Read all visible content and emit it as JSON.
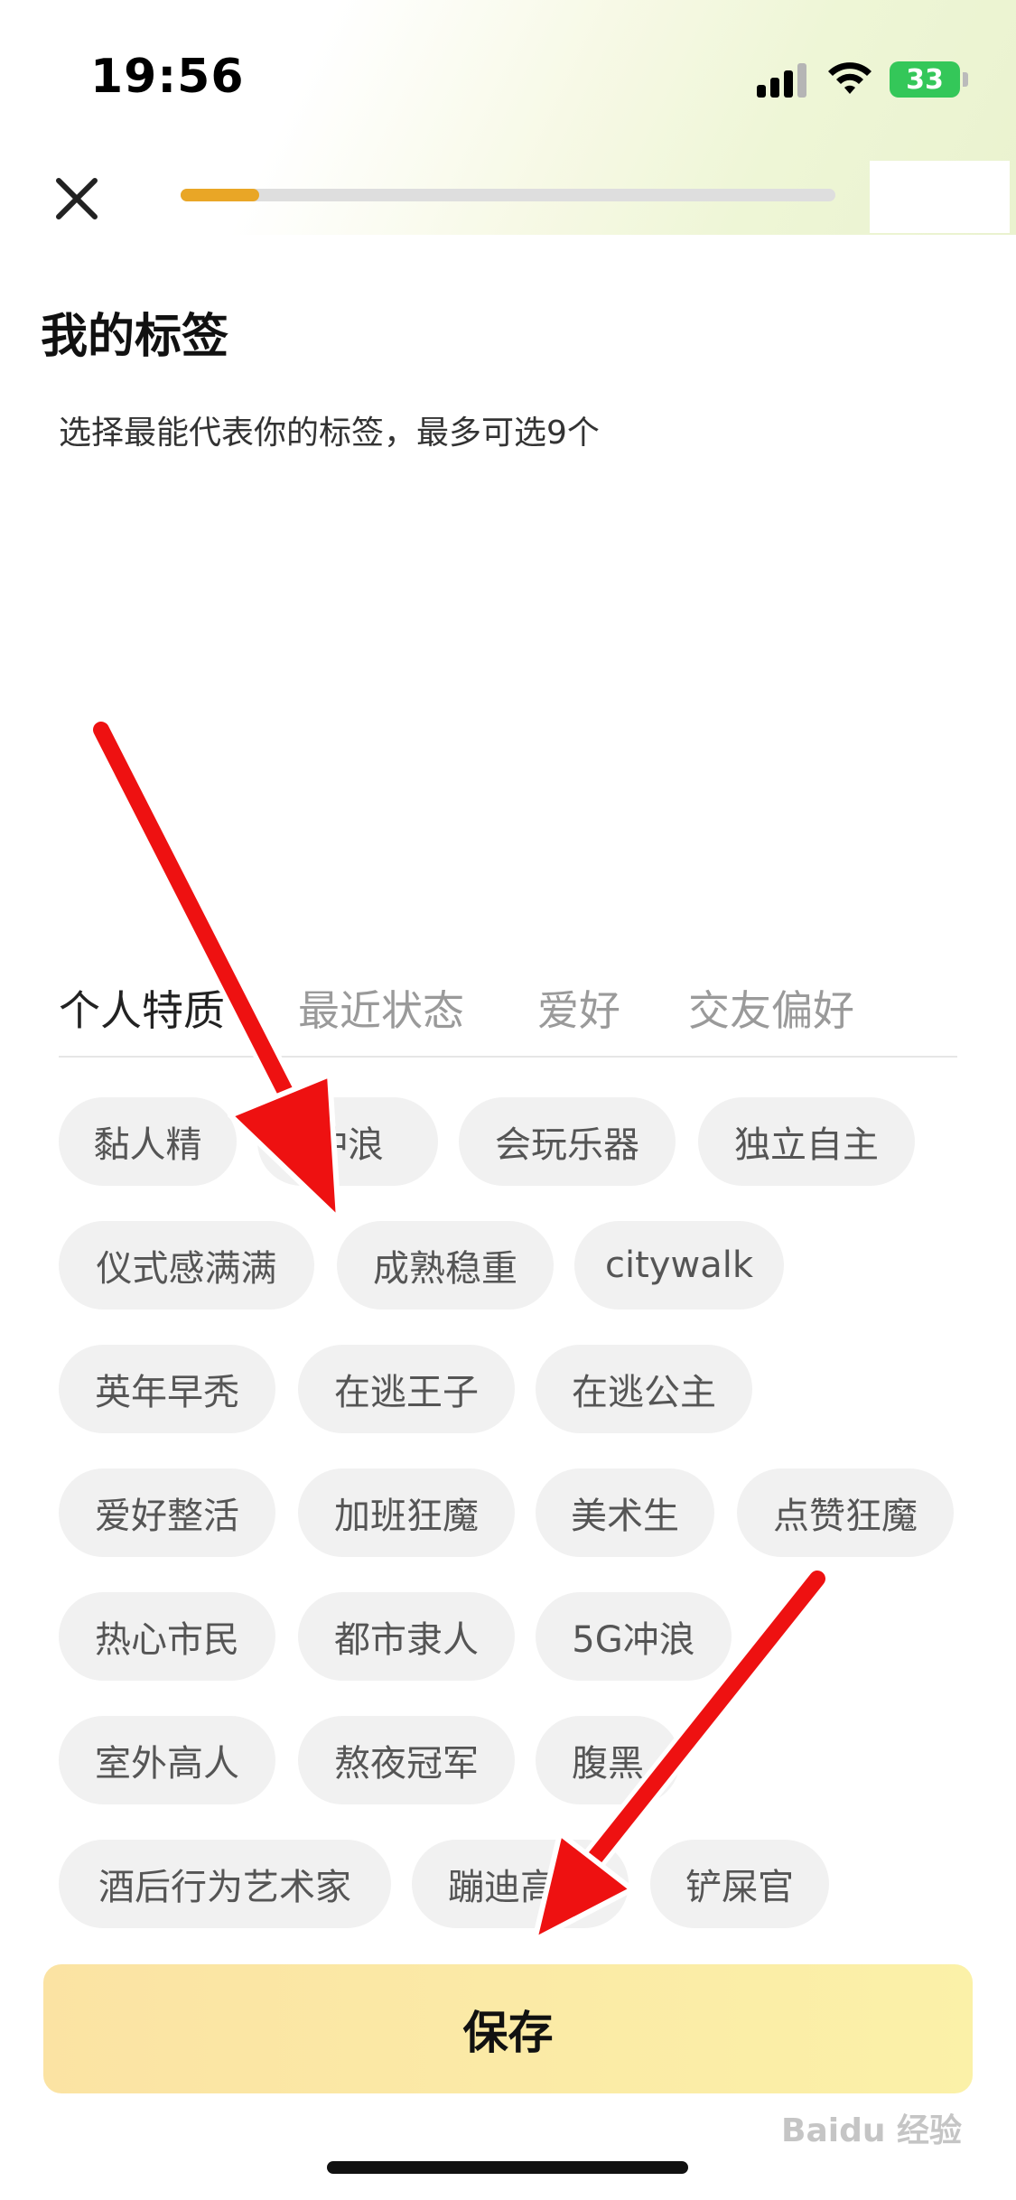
{
  "status_bar": {
    "time": "19:56",
    "battery": "33"
  },
  "header": {
    "progress": 0.12
  },
  "page": {
    "title": "我的标签",
    "subtitle": "选择最能代表你的标签，最多可选9个"
  },
  "tabs": [
    {
      "label": "个人特质",
      "active": true
    },
    {
      "label": "最近状态",
      "active": false
    },
    {
      "label": "爱好",
      "active": false
    },
    {
      "label": "交友偏好",
      "active": false
    }
  ],
  "tags": [
    "黏人精",
    "冲浪",
    "会玩乐器",
    "独立自主",
    "仪式感满满",
    "成熟稳重",
    "citywalk",
    "英年早秃",
    "在逃王子",
    "在逃公主",
    "爱好整活",
    "加班狂魔",
    "美术生",
    "点赞狂魔",
    "热心市民",
    "都市隶人",
    "5G冲浪",
    "室外高人",
    "熬夜冠军",
    "腹黑",
    "酒后行为艺术家",
    "蹦迪高手",
    "铲屎官"
  ],
  "save_label": "保存",
  "watermark": "Baidu 经验",
  "colors": {
    "accent": "#e9a626",
    "arrow": "#ee1111"
  }
}
